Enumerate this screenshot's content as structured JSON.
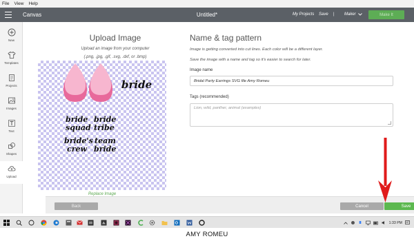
{
  "menu_bar": {
    "items": [
      "File",
      "View",
      "Help"
    ]
  },
  "header": {
    "app_name": "Canvas",
    "doc_title": "Untitled*",
    "my_projects": "My Projects",
    "save": "Save",
    "separator": "|",
    "machine": "Maker",
    "make_it": "Make It"
  },
  "sidebar": {
    "items": [
      {
        "label": "New",
        "icon": "plus-circle-icon"
      },
      {
        "label": "Templates",
        "icon": "shirt-icon"
      },
      {
        "label": "Projects",
        "icon": "folder-icon"
      },
      {
        "label": "Images",
        "icon": "image-icon"
      },
      {
        "label": "Text",
        "icon": "text-icon"
      },
      {
        "label": "Shapes",
        "icon": "shapes-icon"
      },
      {
        "label": "Upload",
        "icon": "upload-cloud-icon"
      }
    ],
    "active": "Upload"
  },
  "upload": {
    "title": "Upload Image",
    "subtitle": "Upload an image from your computer",
    "formats": "(.png, .jpg, .gif, .svg, .dxf, or .bmp)",
    "replace_link": "Replace Image",
    "art_words": {
      "bride": "bride",
      "bride_squad_1": "bride",
      "bride_squad_2": "squad",
      "bride_tribe_1": "bride",
      "bride_tribe_2": "tribe",
      "brides_crew_1": "bride's",
      "brides_crew_2": "crew",
      "team_bride_1": "team",
      "team_bride_2": "bride"
    },
    "earring_colors": {
      "outer": "#e8699b",
      "inner": "#f7b6cf"
    }
  },
  "tag_pattern": {
    "title": "Name & tag pattern",
    "desc1": "Image is getting converted into cut lines. Each color will be a different layer.",
    "desc2": "Save the image with a name and tag so it's easier to search for later.",
    "image_name_label": "Image name",
    "image_name_value": "Bridal Party Earrings SVG file Amy Romeu",
    "tags_label": "Tags (recommended)",
    "tags_placeholder": "Lion, wild, panther, animal (examples)"
  },
  "footer": {
    "back": "Back",
    "cancel": "Cancel",
    "save": "Save"
  },
  "taskbar": {
    "time": "1:33 PM",
    "search_placeholder": "Search"
  },
  "watermark": "AMY ROMEU",
  "colors": {
    "header_bg": "#5b6066",
    "accent_green": "#5cb84f",
    "arrow_red": "#e01b1b",
    "checker": "#c9c4f0"
  }
}
